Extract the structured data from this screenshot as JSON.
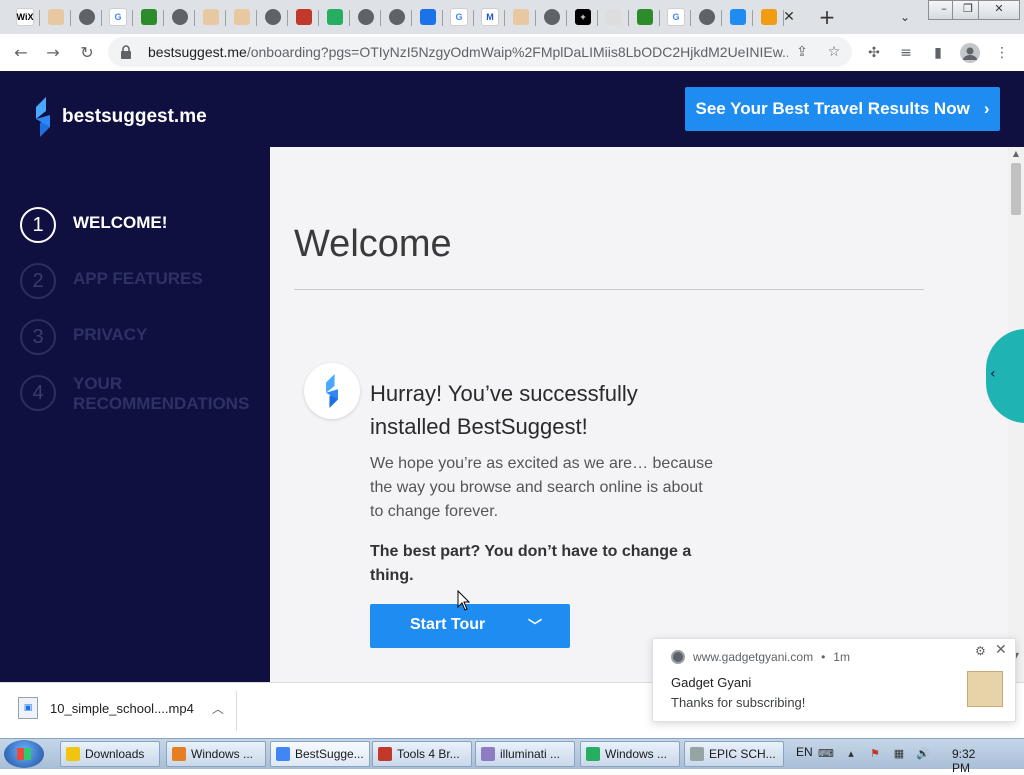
{
  "browser": {
    "tabs": [
      {
        "icon": "wix-icon",
        "label": "WiX",
        "color": "#ffffff",
        "fg": "#000000"
      },
      {
        "icon": "triangle-icon",
        "label": "",
        "color": "#e8c8a0",
        "fg": "#8a5a2a"
      },
      {
        "icon": "globe-icon",
        "label": "",
        "color": "#5f6368",
        "fg": "#ffffff"
      },
      {
        "icon": "google-icon",
        "label": "G",
        "color": "#ffffff",
        "fg": "#4285f4"
      },
      {
        "icon": "gear-icon",
        "label": "",
        "color": "#2c8c2c",
        "fg": "#ffffff"
      },
      {
        "icon": "globe-icon",
        "label": "",
        "color": "#5f6368",
        "fg": "#ffffff"
      },
      {
        "icon": "triangle-icon",
        "label": "",
        "color": "#e8c8a0",
        "fg": "#8a5a2a"
      },
      {
        "icon": "triangle-icon",
        "label": "",
        "color": "#e8c8a0",
        "fg": "#8a5a2a"
      },
      {
        "icon": "globe-icon",
        "label": "",
        "color": "#5f6368",
        "fg": "#ffffff"
      },
      {
        "icon": "fire-icon",
        "label": "",
        "color": "#c0392b",
        "fg": "#ffffff"
      },
      {
        "icon": "check-icon",
        "label": "",
        "color": "#27ae60",
        "fg": "#ffffff"
      },
      {
        "icon": "globe-icon",
        "label": "",
        "color": "#5f6368",
        "fg": "#ffffff"
      },
      {
        "icon": "globe-icon",
        "label": "",
        "color": "#5f6368",
        "fg": "#ffffff"
      },
      {
        "icon": "cloud-icon",
        "label": "",
        "color": "#1a73e8",
        "fg": "#ffffff"
      },
      {
        "icon": "google-icon",
        "label": "G",
        "color": "#ffffff",
        "fg": "#4285f4"
      },
      {
        "icon": "malwarebytes-icon",
        "label": "M",
        "color": "#ffffff",
        "fg": "#1a56db"
      },
      {
        "icon": "triangle-icon",
        "label": "",
        "color": "#e8c8a0",
        "fg": "#8a5a2a"
      },
      {
        "icon": "globe-icon",
        "label": "",
        "color": "#5f6368",
        "fg": "#ffffff"
      },
      {
        "icon": "plus-box-icon",
        "label": "+",
        "color": "#000000",
        "fg": "#ffffff"
      },
      {
        "icon": "grid-icon",
        "label": "",
        "color": "#dddddd",
        "fg": "#333333"
      },
      {
        "icon": "gear-icon",
        "label": "",
        "color": "#2c8c2c",
        "fg": "#ffffff"
      },
      {
        "icon": "google-icon",
        "label": "G",
        "color": "#ffffff",
        "fg": "#4285f4"
      },
      {
        "icon": "globe-icon",
        "label": "",
        "color": "#5f6368",
        "fg": "#ffffff"
      },
      {
        "icon": "bestsuggest-icon",
        "label": "",
        "color": "#1e8cf0",
        "fg": "#ffffff"
      },
      {
        "icon": "rainbow-icon",
        "label": "",
        "color": "#f39c12",
        "fg": "#ffffff"
      }
    ],
    "url_host": "bestsuggest.me",
    "url_path": "/onboarding?pgs=OTIyNzI5NzgyOdmWaip%2FMplDaLIMiis8LbODC2HjkdM2UeINIEw...",
    "window_buttons": {
      "minimize": "–",
      "restore": "❐",
      "close": "✕"
    }
  },
  "page": {
    "logo_text": "bestsuggest.me",
    "cta_label": "See Your Best Travel Results Now",
    "steps": [
      {
        "num": "1",
        "label": "WELCOME!",
        "active": true
      },
      {
        "num": "2",
        "label": "APP FEATURES",
        "active": false
      },
      {
        "num": "3",
        "label": "PRIVACY",
        "active": false
      },
      {
        "num": "4",
        "label": "YOUR RECOMMENDATIONS",
        "active": false
      }
    ],
    "title": "Welcome",
    "headline": "Hurray! You’ve successfully installed BestSuggest!",
    "paragraph": "We hope you’re as excited as we are… because the way you browse and search online is about to change forever.",
    "bold_text": "The best part? You don’t have to change a thing.",
    "button_label": "Start Tour",
    "colors": {
      "navy": "#0f1040",
      "blue": "#1e8cf0",
      "teal": "#1fb4b3"
    }
  },
  "download": {
    "filename": "10_simple_school....mp4"
  },
  "notification": {
    "source": "www.gadgetgyani.com",
    "age": "1m",
    "title": "Gadget Gyani",
    "body": "Thanks for subscribing!"
  },
  "taskbar": {
    "items": [
      {
        "label": "Downloads",
        "color": "#f1c40f"
      },
      {
        "label": "Windows ...",
        "color": "#e67e22"
      },
      {
        "label": "BestSugge...",
        "color": "#4285f4",
        "active": true
      },
      {
        "label": "Tools 4 Br...",
        "color": "#c0392b"
      },
      {
        "label": "illuminati ...",
        "color": "#8e7cc3"
      },
      {
        "label": "Windows ...",
        "color": "#27ae60"
      },
      {
        "label": "EPIC SCH...",
        "color": "#95a5a6"
      }
    ],
    "language": "EN",
    "time": "9:32 PM"
  }
}
